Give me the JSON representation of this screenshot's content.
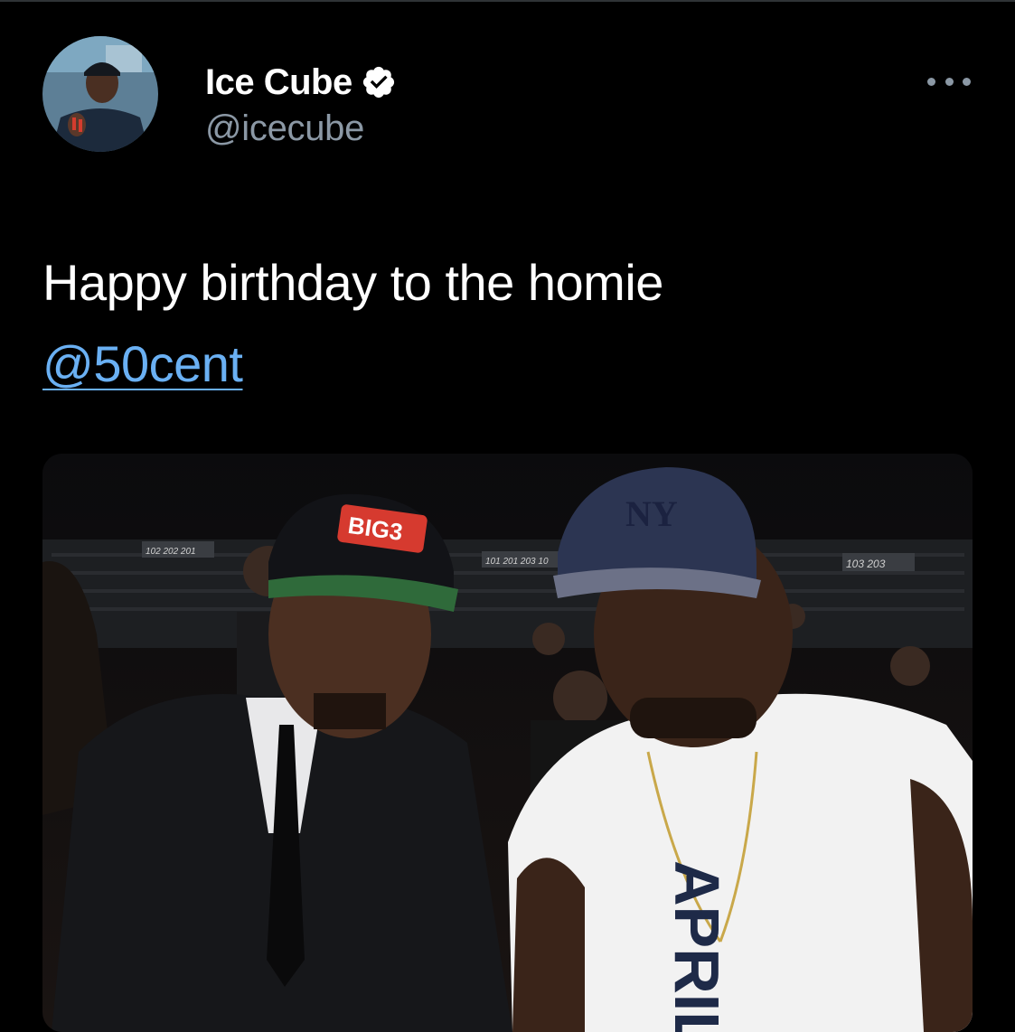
{
  "tweet": {
    "author": {
      "display_name": "Ice Cube",
      "handle": "@icecube",
      "verified": true,
      "avatar_icon": "profile-photo"
    },
    "text": "Happy birthday to the homie",
    "mention": "@50cent",
    "more_icon": "more-horizontal-icon",
    "media": {
      "type": "photo",
      "cap_logo_left": "BIG3",
      "cap_logo_right": "NY",
      "arena_signs": [
        "102 202 201",
        "101 201 203 10",
        "103 203"
      ],
      "shirt_text": "APRIL"
    }
  },
  "colors": {
    "background": "#000000",
    "text_primary": "#ffffff",
    "text_secondary": "#8b98a5",
    "link": "#6ab0f3",
    "verified_badge": "#ffffff"
  }
}
